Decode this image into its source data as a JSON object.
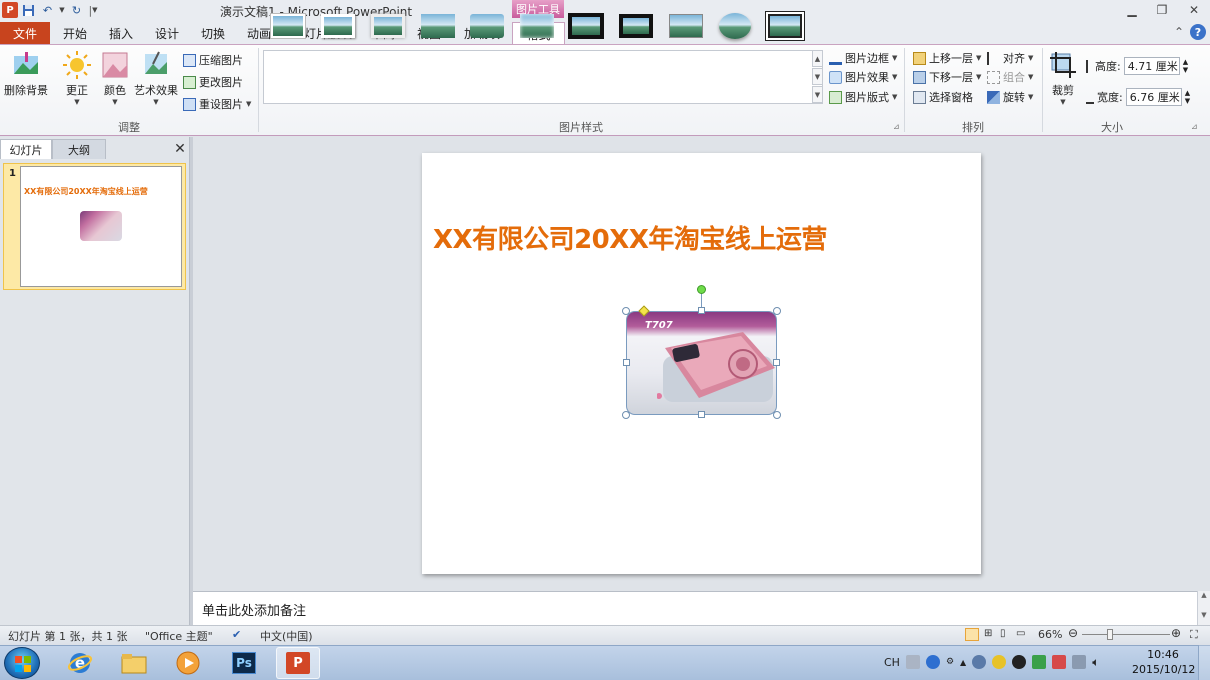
{
  "app": {
    "window_title": "演示文稿1 - Microsoft PowerPoint",
    "context_tab_group": "图片工具",
    "icon_letter": "P"
  },
  "tabs": [
    {
      "label": "文件"
    },
    {
      "label": "开始"
    },
    {
      "label": "插入"
    },
    {
      "label": "设计"
    },
    {
      "label": "切换"
    },
    {
      "label": "动画"
    },
    {
      "label": "幻灯片放映"
    },
    {
      "label": "审阅"
    },
    {
      "label": "视图"
    },
    {
      "label": "加载项"
    },
    {
      "label": "格式"
    }
  ],
  "ribbon": {
    "adjust": {
      "label": "调整",
      "remove_bg": "删除背景",
      "corrections": "更正",
      "color": "颜色",
      "artistic": "艺术效果",
      "compress": "压缩图片",
      "change": "更改图片",
      "reset": "重设图片"
    },
    "styles": {
      "label": "图片样式",
      "border": "图片边框",
      "effects": "图片效果",
      "layout": "图片版式"
    },
    "arrange": {
      "label": "排列",
      "bring_forward": "上移一层",
      "send_backward": "下移一层",
      "selection_pane": "选择窗格",
      "align": "对齐",
      "group": "组合",
      "rotate": "旋转"
    },
    "size": {
      "label": "大小",
      "crop": "裁剪",
      "height_label": "高度:",
      "height_value": "4.71 厘米",
      "width_label": "宽度:",
      "width_value": "6.76 厘米"
    }
  },
  "left_pane": {
    "tab_slides": "幻灯片",
    "tab_outline": "大纲",
    "slide_number": "1",
    "thumb_title": "XX有限公司20XX年淘宝线上运营"
  },
  "slide": {
    "title": "XX有限公司20XX年淘宝线上运营",
    "picture_label": "T707"
  },
  "notes": {
    "placeholder": "单击此处添加备注"
  },
  "status": {
    "slide_info": "幻灯片 第 1 张，共 1 张",
    "theme": "\"Office 主题\"",
    "language": "中文(中国)",
    "zoom": "66%"
  },
  "taskbar": {
    "ime": "CH",
    "time": "10:46",
    "date": "2015/10/12"
  }
}
